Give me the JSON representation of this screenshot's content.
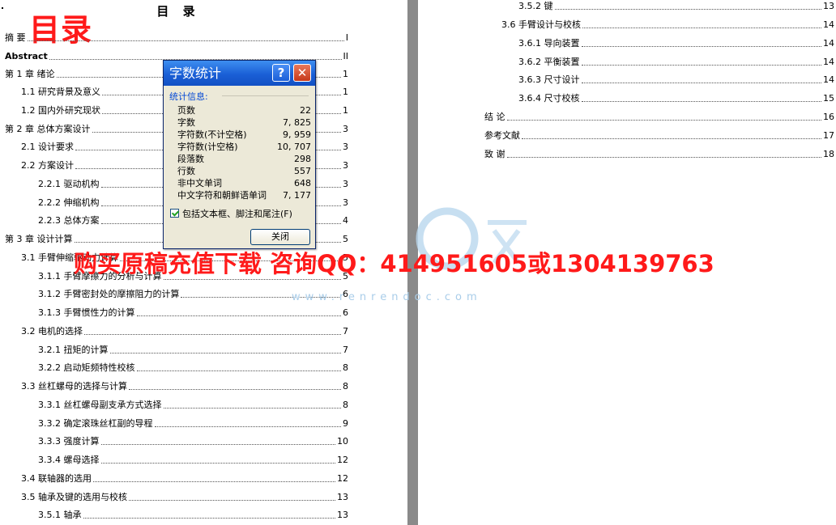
{
  "document": {
    "toc_title": "目 录",
    "red_heading": "目录",
    "left_toc": [
      {
        "label": "摘  要",
        "page": "I"
      },
      {
        "label": "Abstract",
        "page": "II"
      },
      {
        "label": "第 1 章  绪论",
        "page": "1"
      },
      {
        "label": "1.1 研究背景及意义",
        "page": "1"
      },
      {
        "label": "1.2 国内外研究现状",
        "page": "1"
      },
      {
        "label": "第 2 章  总体方案设计",
        "page": "3"
      },
      {
        "label": "2.1 设计要求",
        "page": "3"
      },
      {
        "label": "2.2 方案设计",
        "page": "3"
      },
      {
        "label": "2.2.1 驱动机构",
        "page": "3"
      },
      {
        "label": "2.2.2 伸缩机构",
        "page": "3"
      },
      {
        "label": "2.2.3 总体方案",
        "page": "4"
      },
      {
        "label": "第 3 章  设计计算",
        "page": "5"
      },
      {
        "label": "3.1 手臂伸缩驱动力计算",
        "page": "5"
      },
      {
        "label": "3.1.1  手臂摩擦力的分析与计算",
        "page": "5"
      },
      {
        "label": "3.1.2 手臂密封处的摩擦阻力的计算",
        "page": "6"
      },
      {
        "label": "3.1.3 手臂惯性力的计算",
        "page": "6"
      },
      {
        "label": "3.2 电机的选择",
        "page": "7"
      },
      {
        "label": "3.2.1  扭矩的计算",
        "page": "7"
      },
      {
        "label": "3.2.2  启动矩频特性校核",
        "page": "8"
      },
      {
        "label": "3.3 丝杠螺母的选择与计算",
        "page": "8"
      },
      {
        "label": "3.3.1 丝杠螺母副支承方式选择",
        "page": "8"
      },
      {
        "label": "3.3.2 确定滚珠丝杠副的导程",
        "page": "9"
      },
      {
        "label": "3.3.3 强度计算",
        "page": "10"
      },
      {
        "label": "3.3.4 螺母选择",
        "page": "12"
      },
      {
        "label": "3.4 联轴器的选用",
        "page": "12"
      },
      {
        "label": "3.5 轴承及键的选用与校核",
        "page": "13"
      },
      {
        "label": "3.5.1 轴承",
        "page": "13"
      }
    ],
    "right_toc": [
      {
        "label": "3.5.2 键",
        "page": "13"
      },
      {
        "label": "3.6 手臂设计与校核",
        "page": "14"
      },
      {
        "label": "3.6.1 导向装置",
        "page": "14"
      },
      {
        "label": "3.6.2 平衡装置",
        "page": "14"
      },
      {
        "label": "3.6.3 尺寸设计",
        "page": "14"
      },
      {
        "label": "3.6.4 尺寸校核",
        "page": "15"
      },
      {
        "label": "结  论",
        "page": "16"
      },
      {
        "label": "参考文献",
        "page": "17"
      },
      {
        "label": "致  谢",
        "page": "18"
      }
    ]
  },
  "dialog": {
    "title": "字数统计",
    "help_label": "?",
    "close_label": "✕",
    "group_label": "统计信息:",
    "stats": [
      {
        "label": "页数",
        "value": "22"
      },
      {
        "label": "字数",
        "value": "7, 825"
      },
      {
        "label": "字符数(不计空格)",
        "value": "9, 959"
      },
      {
        "label": "字符数(计空格)",
        "value": "10, 707"
      },
      {
        "label": "段落数",
        "value": "298"
      },
      {
        "label": "行数",
        "value": "557"
      },
      {
        "label": "非中文单词",
        "value": "648"
      },
      {
        "label": "中文字符和朝鲜语单词",
        "value": "7, 177"
      }
    ],
    "include_checkbox_label": "包括文本框、脚注和尾注(F)",
    "include_checked": true,
    "close_button": "关闭"
  },
  "overlay": {
    "red_banner": "购买原稿充值下载  咨询QQ：414951605或1304139763",
    "watermark_url": "www.renrendoc.com",
    "watermark_accent": "#a9cde9",
    "red_color": "#ff1a1a"
  }
}
